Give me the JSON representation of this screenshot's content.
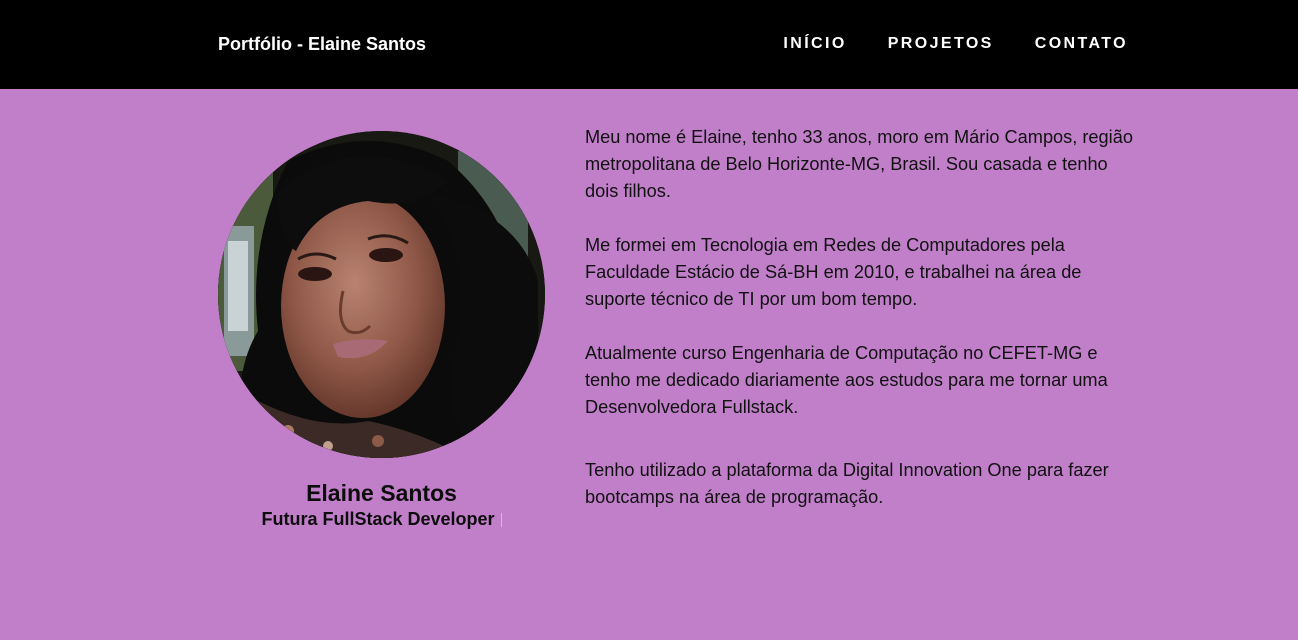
{
  "header": {
    "brand": "Portfólio - Elaine Santos",
    "nav": [
      {
        "label": "INÍCIO"
      },
      {
        "label": "PROJETOS"
      },
      {
        "label": "CONTATO"
      }
    ]
  },
  "profile": {
    "name": "Elaine Santos",
    "role": "Futura FullStack Developer"
  },
  "about": {
    "paragraphs": [
      "Meu nome é Elaine, tenho 33 anos, moro em Mário Campos, região metropolitana de Belo Horizonte-MG, Brasil. Sou casada e tenho dois filhos.",
      "Me formei em Tecnologia em Redes de Computadores pela Faculdade Estácio de Sá-BH em 2010, e trabalhei na área de suporte técnico de TI por um bom tempo.",
      "Atualmente curso Engenharia de Computação no CEFET-MG e tenho me dedicado diariamente aos estudos para me tornar uma Desenvolvedora Fullstack.",
      "Tenho utilizado a plataforma da Digital Innovation One para fazer bootcamps na área de programação."
    ]
  },
  "colors": {
    "page_background": "#c17fca",
    "navbar_background": "#000000",
    "nav_text": "#ffffff",
    "body_text": "#111111"
  }
}
